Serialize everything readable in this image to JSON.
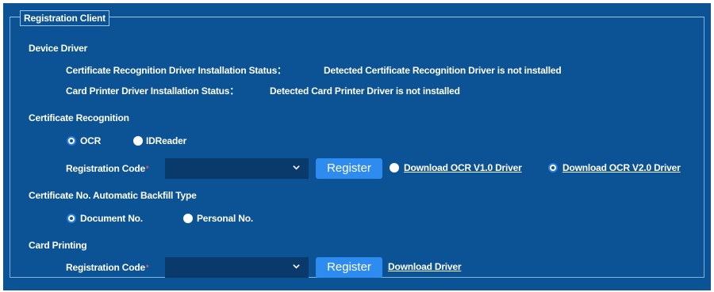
{
  "fieldset": {
    "legend": "Registration Client"
  },
  "device_driver": {
    "heading": "Device Driver",
    "cert_driver_label": "Certificate Recognition Driver Installation Status：",
    "cert_driver_value": "Detected Certificate Recognition Driver is not installed",
    "printer_driver_label": "Card Printer Driver Installation Status：",
    "printer_driver_value": "Detected Card Printer Driver is not installed"
  },
  "certificate_recognition": {
    "heading": "Certificate Recognition",
    "options": [
      {
        "label": "OCR",
        "selected": true
      },
      {
        "label": "IDReader",
        "selected": false
      }
    ],
    "registration_code_label": "Registration Code",
    "required_marker": "*",
    "registration_code_value": "",
    "register_button": "Register",
    "download_options": [
      {
        "label": "Download OCR V1.0 Driver",
        "selected": false
      },
      {
        "label": "Download OCR V2.0 Driver",
        "selected": true
      }
    ]
  },
  "backfill": {
    "heading": "Certificate No. Automatic Backfill Type",
    "options": [
      {
        "label": "Document No.",
        "selected": true
      },
      {
        "label": "Personal No.",
        "selected": false
      }
    ]
  },
  "card_printing": {
    "heading": "Card Printing",
    "registration_code_label": "Registration Code",
    "required_marker": "*",
    "registration_code_value": "",
    "register_button": "Register",
    "download_link": "Download Driver"
  },
  "colors": {
    "panel_bg": "#0b5394",
    "select_bg": "#0a3a6b",
    "button_bg": "#2e8cf0",
    "radio_selected_ring": "#2a7de1",
    "required": "#ff5a5a"
  },
  "icons": {
    "select_arrow": "chevron-down-icon"
  }
}
